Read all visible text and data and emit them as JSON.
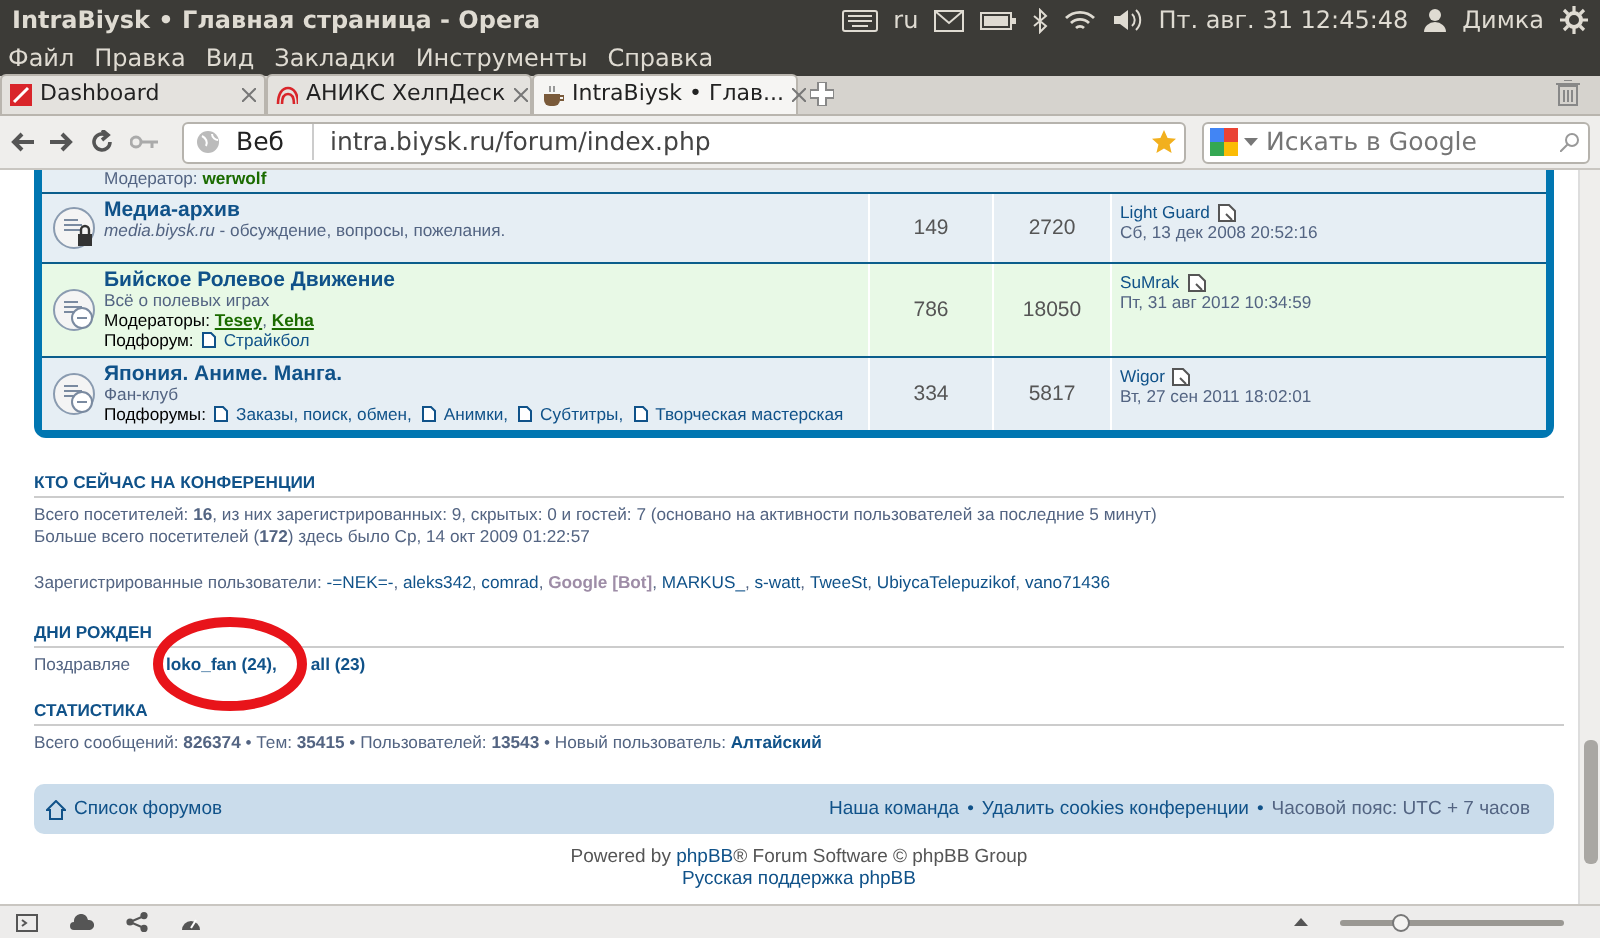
{
  "window": {
    "title": "IntraBiysk • Главная страница - Opera"
  },
  "top_panel": {
    "keyboard": "ru",
    "clock": "Пт. авг. 31 12:45:48",
    "user": "Димка"
  },
  "menu": [
    "Файл",
    "Правка",
    "Вид",
    "Закладки",
    "Инструменты",
    "Справка"
  ],
  "tabs": [
    {
      "label": "Dashboard",
      "selected": false
    },
    {
      "label": "АНИКС ХелпДеск",
      "selected": false
    },
    {
      "label": "IntraBiysk • Глав...",
      "selected": true
    }
  ],
  "address_bar": {
    "scope": "Веб",
    "url": "intra.biysk.ru/forum/index.php",
    "search_placeholder": "Искать в Google"
  },
  "forum": {
    "partial_row": {
      "label": "Модератор:",
      "moderator": "werwolf"
    },
    "separator": ", ",
    "rows": [
      {
        "title": "Медиа-архив",
        "description": "*media.biysk.ru* - обсуждение, вопросы, пожелания.",
        "locked": true,
        "hovered": false,
        "topics": "149",
        "posts": "2720",
        "last_author": "Light Guard",
        "last_time": "Сб, 13 дек 2008 20:52:16"
      },
      {
        "title": "Бийское Ролевое Движение",
        "description": "Всё о полевых играх",
        "moderators_label": "Модераторы:",
        "moderators": [
          "Tesey",
          "Keha"
        ],
        "subforums_label": "Подфорум:",
        "subforums": [
          "Страйкбол"
        ],
        "locked": false,
        "hovered": true,
        "topics": "786",
        "posts": "18050",
        "last_author": "SuMrak",
        "last_time": "Пт, 31 авг 2012 10:34:59"
      },
      {
        "title": "Япония. Аниме. Манга.",
        "description": "Фан-клуб",
        "subforums_label": "Подфорумы:",
        "subforums": [
          "Заказы, поиск, обмен",
          "Анимки",
          "Субтитры",
          "Творческая мастерская"
        ],
        "locked": false,
        "hovered": false,
        "topics": "334",
        "posts": "5817",
        "last_author": "Wigor",
        "last_time": "Вт, 27 сен 2011 18:02:01"
      }
    ]
  },
  "who_is_online": {
    "heading": "КТО СЕЙЧАС НА КОНФЕРЕНЦИИ",
    "lines": [
      "Всего посетителей: **16**, из них зарегистрированных: 9, скрытых: 0 и гостей: 7 (основано на активности пользователей за последние 5 минут)",
      "Больше всего посетителей (**172**) здесь было Ср, 14 окт 2009 01:22:57"
    ],
    "registered_label": "Зарегистрированные пользователи:",
    "separator": ", ",
    "users": [
      {
        "name": "-=NEK=-",
        "color": "#105289"
      },
      {
        "name": "aleks342",
        "color": "#105289"
      },
      {
        "name": "comrad",
        "color": "#105289"
      },
      {
        "name": "Google [Bot]",
        "color": "#9e8da7"
      },
      {
        "name": "MARKUS_",
        "color": "#105289"
      },
      {
        "name": "s-watt",
        "color": "#105289"
      },
      {
        "name": "TweeSt",
        "color": "#105289"
      },
      {
        "name": "UbiycaTelepuzikof",
        "color": "#105289"
      },
      {
        "name": "vano71436",
        "color": "#105289"
      }
    ]
  },
  "birthdays": {
    "heading": "ДНИ РОЖДЕН",
    "label": "Поздравляе",
    "users": [
      "loko_fan (24),",
      "all (23)"
    ]
  },
  "statistics": {
    "heading": "СТАТИСТИКА",
    "text": "Всего сообщений: **826374** • Тем: **35415** • Пользователей: **13543** • Новый пользователь:",
    "new_user": "Алтайский"
  },
  "footer_nav": {
    "home": "Список форумов",
    "separator": "•",
    "links": [
      "Наша команда",
      "Удалить cookies конференции"
    ],
    "timezone": "Часовой пояс: UTC + 7 часов"
  },
  "credits": {
    "prefix": "Powered by",
    "link": "phpBB",
    "suffix": "® Forum Software © phpBB Group",
    "support": "Русская поддержка phpBB"
  },
  "status_bar": {
    "zoom": {
      "level": 0.27
    }
  }
}
